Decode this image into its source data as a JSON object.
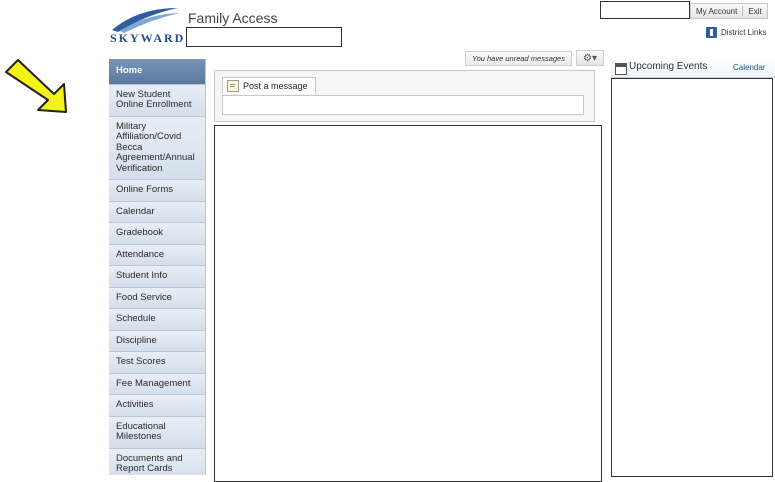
{
  "header": {
    "logo_text": "SKYWARD",
    "app_title": "Family Access",
    "my_account": "My Account",
    "exit": "Exit",
    "district_links": "District Links"
  },
  "sidebar": {
    "items": [
      {
        "label": "Home",
        "active": true
      },
      {
        "label": "New Student Online Enrollment"
      },
      {
        "label": "Military Affiliation/Covid Becca Agreement/Annual Verification"
      },
      {
        "label": "Online Forms"
      },
      {
        "label": "Calendar"
      },
      {
        "label": "Gradebook"
      },
      {
        "label": "Attendance"
      },
      {
        "label": "Student Info"
      },
      {
        "label": "Food Service"
      },
      {
        "label": "Schedule"
      },
      {
        "label": "Discipline"
      },
      {
        "label": "Test Scores"
      },
      {
        "label": "Fee Management"
      },
      {
        "label": "Activities"
      },
      {
        "label": "Educational Milestones"
      },
      {
        "label": "Documents and Report Cards"
      }
    ]
  },
  "main": {
    "unread_messages": "You have unread messages",
    "post_message_label": "Post a message"
  },
  "right": {
    "upcoming_events": "Upcoming Events",
    "calendar_link": "Calendar"
  },
  "colors": {
    "accent": "#2d5e9e",
    "sidebar_active": "#6a86ad",
    "arrow": "#f3f31a"
  }
}
